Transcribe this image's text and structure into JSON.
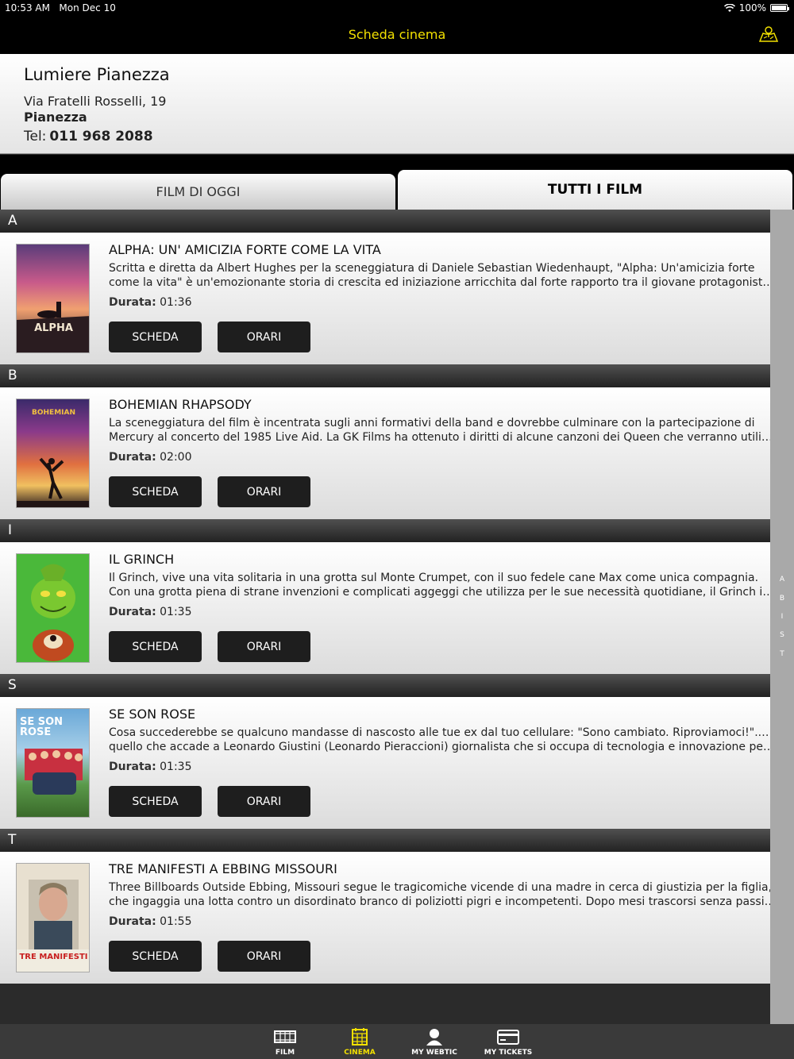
{
  "status": {
    "time": "10:53 AM",
    "date": "Mon Dec 10",
    "battery": "100%"
  },
  "nav": {
    "title": "Scheda cinema"
  },
  "cinema": {
    "name": "Lumiere Pianezza",
    "street": "Via Fratelli Rosselli, 19",
    "city": "Pianezza",
    "tel_label": "Tel:",
    "tel": "011 968 2088"
  },
  "tabs": {
    "today": "FILM DI OGGI",
    "all": "TUTTI I FILM"
  },
  "labels": {
    "duration": "Durata:",
    "scheda": "SCHEDA",
    "orari": "ORARI"
  },
  "sections": [
    {
      "letter": "A",
      "film": {
        "title": "ALPHA: UN' AMICIZIA FORTE COME LA VITA",
        "desc1": "Scritta e diretta da Albert Hughes per la sceneggiatura di Daniele Sebastian Wiedenhaupt, \"Alpha: Un'amicizia forte",
        "desc2": "come la vita\" è un'emozionante storia di crescita ed iniziazione arricchita dal forte rapporto tra il giovane protagonista e il lupo",
        "duration": "01:36",
        "poster_text": "ALPHA"
      }
    },
    {
      "letter": "B",
      "film": {
        "title": "BOHEMIAN RHAPSODY",
        "desc1": "La sceneggiatura del film è incentrata sugli anni formativi della band e dovrebbe culminare con la partecipazione di",
        "desc2": "Mercury al concerto del 1985 Live Aid. La GK Films ha ottenuto i diritti di alcune canzoni dei Queen che verranno utilizzate nel film",
        "duration": "02:00",
        "poster_text": "BOHEMIAN"
      }
    },
    {
      "letter": "I",
      "film": {
        "title": "IL GRINCH",
        "desc1": "Il Grinch, vive una vita solitaria in una grotta sul Monte Crumpet, con il suo fedele cane Max come unica compagnia.",
        "desc2": "Con una grotta piena di strane invenzioni e complicati aggeggi che utilizza per le sue necessità quotidiane, il Grinch incontra",
        "duration": "01:35",
        "poster_text": ""
      }
    },
    {
      "letter": "S",
      "film": {
        "title": "SE SON ROSE",
        "desc1": "Cosa succederebbe se qualcuno mandasse di nascosto alle tue ex dal tuo cellulare: \"Sono cambiato. Riproviamoci!\"..? E'",
        "desc2": "quello che accade a Leonardo Giustini (Leonardo Pieraccioni) giornalista che si occupa di tecnologia e innovazione per un sito web",
        "duration": "01:35",
        "poster_text": "SE SON ROSE"
      }
    },
    {
      "letter": "T",
      "film": {
        "title": "TRE MANIFESTI A EBBING MISSOURI",
        "desc1": "Three Billboards Outside Ebbing, Missouri segue le tragicomiche vicende di una madre in cerca di giustizia per la figlia,",
        "desc2": "che ingaggia una lotta contro un disordinato branco di poliziotti pigri e incompetenti. Dopo mesi trascorsi senza passi avanti",
        "duration": "01:55",
        "poster_text": "TRE MANIFESTI"
      }
    }
  ],
  "index": [
    "A",
    "B",
    "I",
    "S",
    "T"
  ],
  "tabbar": {
    "film": "FILM",
    "cinema": "CINEMA",
    "webtic": "MY WEBTIC",
    "tickets": "MY TICKETS"
  },
  "colors": {
    "accent": "#f2e000",
    "header_bg": "#000000"
  }
}
